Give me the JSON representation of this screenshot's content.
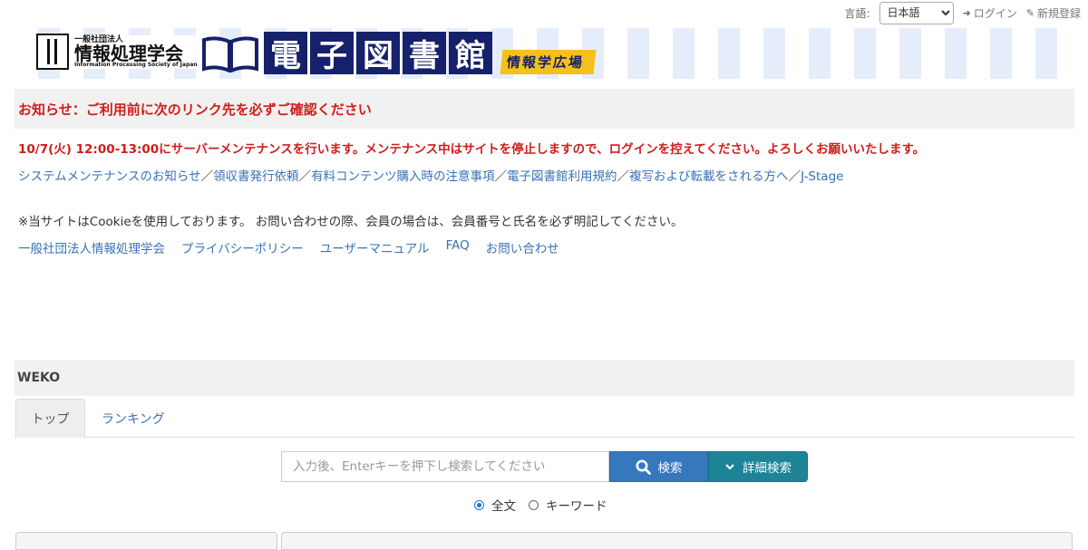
{
  "topbar": {
    "lang_label": "言語:",
    "lang_selected": "日本語",
    "login": "ログイン",
    "signup": "新規登録"
  },
  "banner": {
    "org_small": "一般社団法人",
    "org_name": "情報処理学会",
    "org_en": "Information Processing Society of Japan",
    "library_chars": [
      "電",
      "子",
      "図",
      "書",
      "館"
    ],
    "tag": "情報学広場"
  },
  "notice": {
    "heading": "お知らせ：ご利用前に次のリンク先を必ずご確認ください",
    "maintenance": "10/7(火) 12:00-13:00にサーバーメンテナンスを行います。メンテナンス中はサイトを停止しますので、ログインを控えてください。よろしくお願いいたします。",
    "links": [
      "システムメンテナンスのお知らせ",
      "領収書発行依頼",
      "有料コンテンツ購入時の注意事項",
      "電子図書館利用規約",
      "複写および転載をされる方へ",
      "J-Stage"
    ],
    "separator": "／",
    "cookie": "※当サイトはCookieを使用しております。 お問い合わせの際、会員の場合は、会員番号と氏名を必ず明記してください。",
    "footer_links": [
      "一般社団法人情報処理学会",
      "プライバシーポリシー",
      "ユーザーマニュアル",
      "FAQ",
      "お問い合わせ"
    ]
  },
  "weko": {
    "title": "WEKO",
    "tabs": [
      "トップ",
      "ランキング"
    ]
  },
  "search": {
    "placeholder": "入力後、Enterキーを押下し検索してください",
    "search_button": "検索",
    "advanced_button": "詳細検索",
    "radio_fulltext": "全文",
    "radio_keyword": "キーワード"
  },
  "colors": {
    "notice_red": "#d01d1d",
    "link_blue": "#3a72b5",
    "search_button": "#3578be",
    "advanced_button": "#1d8498",
    "banner_navy": "#16216b",
    "banner_yellow": "#f4c11a"
  }
}
